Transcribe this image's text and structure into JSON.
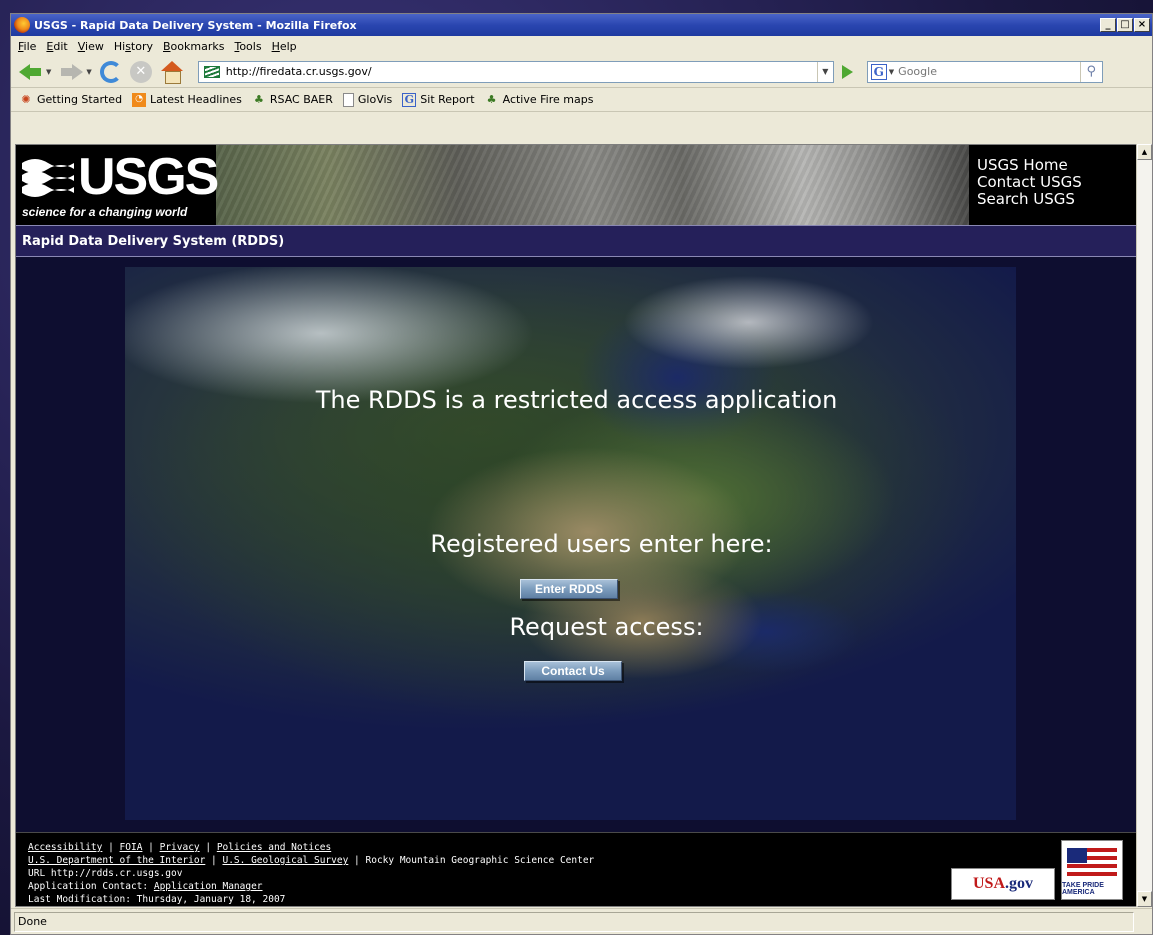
{
  "window": {
    "title": "USGS - Rapid Data Delivery System - Mozilla Firefox",
    "buttons": [
      "_",
      "□",
      "×"
    ]
  },
  "menubar": {
    "items": [
      "File",
      "Edit",
      "View",
      "History",
      "Bookmarks",
      "Tools",
      "Help"
    ],
    "access_keys": [
      "F",
      "E",
      "V",
      "s",
      "B",
      "T",
      "H"
    ]
  },
  "navbar": {
    "url": "http://firedata.cr.usgs.gov/",
    "search_engine": "G",
    "search_placeholder": "Google"
  },
  "bookmarks": [
    {
      "label": "Getting Started",
      "icon": "firefox-icon",
      "color": "#c8441c"
    },
    {
      "label": "Latest Headlines",
      "icon": "rss-icon",
      "color": "#f08a1a"
    },
    {
      "label": "RSAC BAER",
      "icon": "forest-service-icon",
      "color": "#3c7a24"
    },
    {
      "label": "GloVis",
      "icon": "page-icon",
      "color": "#6c7ea8"
    },
    {
      "label": "Sit Report",
      "icon": "google-icon",
      "color": "#3a62c8"
    },
    {
      "label": "Active Fire maps",
      "icon": "forest-service-icon",
      "color": "#3c7a24"
    }
  ],
  "header": {
    "logo_word": "USGS",
    "logo_tagline": "science for a changing world",
    "links": [
      "USGS Home",
      "Contact USGS",
      "Search USGS"
    ],
    "app_title": "Rapid Data Delivery System (RDDS)"
  },
  "main": {
    "restricted": "The RDDS is a restricted access application",
    "registered": "Registered users enter here:",
    "enter_label": "Enter RDDS",
    "request": "Request access:",
    "contact_label": "Contact Us"
  },
  "footer": {
    "line1_links": [
      "Accessibility",
      "FOIA",
      "Privacy",
      "Policies and Notices"
    ],
    "line2_links": [
      "U.S. Department of the Interior",
      "U.S. Geological Survey"
    ],
    "line2_text": "Rocky Mountain Geographic Science Center",
    "url_line": "URL http://rdds.cr.usgs.gov",
    "contact_prefix": "Applicatiion Contact: ",
    "contact_link": "Application Manager",
    "modified": "Last Modification: Thursday, January 18, 2007",
    "usa_gov": "USA",
    "usa_gov_suffix": ".gov",
    "pride_label": "TAKE PRIDE AMERICA"
  },
  "status": {
    "text": "Done"
  }
}
